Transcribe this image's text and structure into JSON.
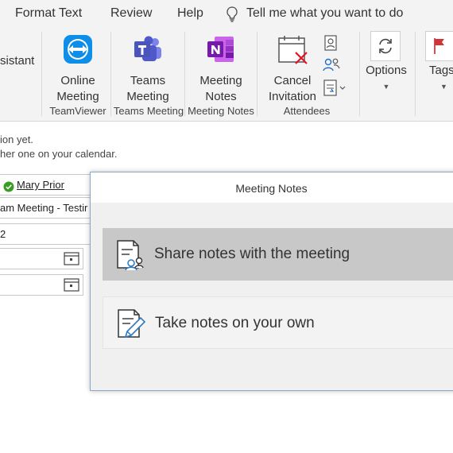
{
  "menu": {
    "format_text": "Format Text",
    "review": "Review",
    "help": "Help",
    "tell_me": "Tell me what you want to do"
  },
  "ribbon": {
    "assistant_partial": "sistant",
    "online_meeting": "Online\nMeeting",
    "teams_meeting": "Teams\nMeeting",
    "meeting_notes": "Meeting\nNotes",
    "cancel_invitation": "Cancel\nInvitation",
    "options": "Options",
    "tags": "Tags",
    "groups": {
      "teamviewer": "TeamViewer",
      "teams_meeting": "Teams Meeting",
      "meeting_notes": "Meeting Notes",
      "attendees": "Attendees"
    }
  },
  "info": {
    "line1": "ion yet.",
    "line2": "her one on your calendar."
  },
  "form": {
    "attendee": "Mary Prior",
    "subject": "am Meeting - Testir",
    "location": "2"
  },
  "dialog": {
    "title": "Meeting Notes",
    "share_option": "Share notes with the meeting",
    "take_option": "Take notes on your own"
  },
  "colors": {
    "teamviewer": "#0e8ee9",
    "teams": "#5059c9",
    "onenote": "#7719aa",
    "cancel_x": "#e81123",
    "share_selected_bg": "#c8c8c8",
    "take_bg": "#f3f3f3"
  }
}
